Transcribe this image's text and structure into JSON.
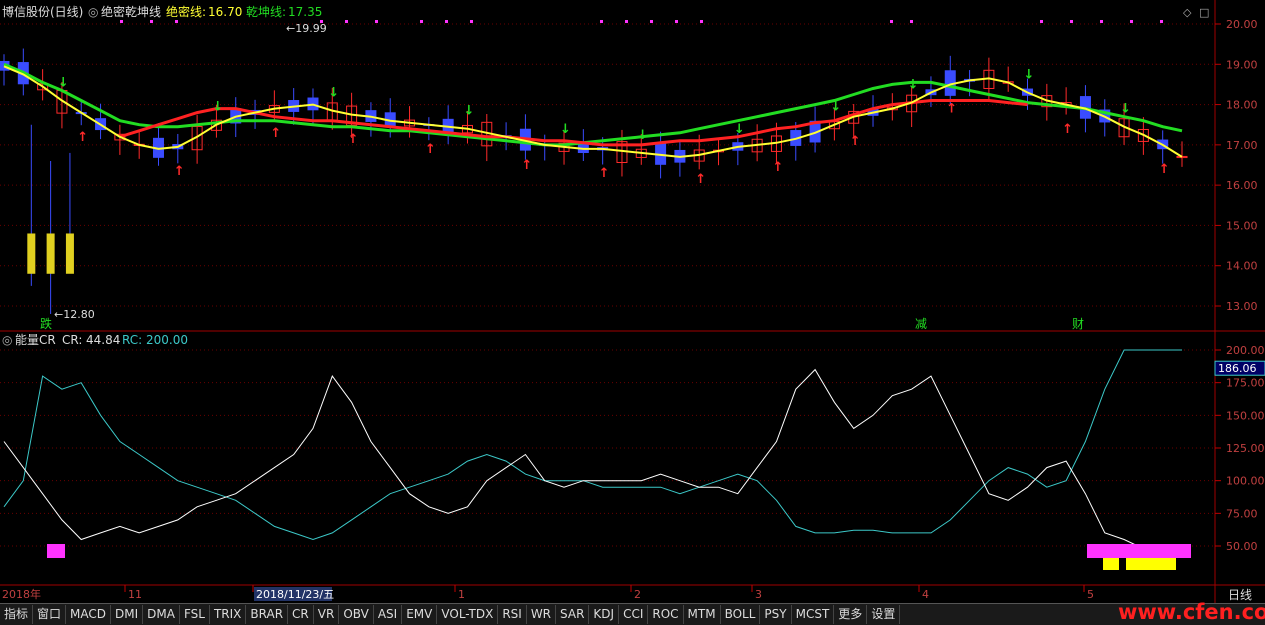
{
  "header": {
    "stock": "博信股份(日线)",
    "indicator": "绝密乾坤线",
    "line1_label": "绝密线:",
    "line1_value": "16.70",
    "line2_label": "乾坤线:",
    "line2_value": "17.35"
  },
  "sub_header": {
    "indicator": "能量CR",
    "cr_label": "CR:",
    "cr_value": "44.84",
    "rc_label": "RC:",
    "rc_value": "200.00"
  },
  "chart_data": [
    {
      "type": "candlestick",
      "title": "绝密乾坤线",
      "ylim": [
        12.6,
        20.3
      ],
      "y_ticks": [
        "20.00",
        "19.00",
        "18.00",
        "17.00",
        "16.00",
        "15.00",
        "14.00",
        "13.00"
      ],
      "annotations": {
        "high": "19.99",
        "low": "12.80"
      },
      "markers": [
        "跌",
        "减",
        "财"
      ],
      "series": [
        {
          "name": "绝密线",
          "color": "#ffff33",
          "values": [
            18.95,
            18.75,
            18.45,
            18.1,
            17.8,
            17.5,
            17.2,
            17.0,
            16.9,
            16.95,
            17.2,
            17.5,
            17.7,
            17.8,
            17.9,
            17.95,
            18.0,
            17.85,
            17.75,
            17.7,
            17.6,
            17.55,
            17.5,
            17.45,
            17.4,
            17.3,
            17.2,
            17.1,
            17.0,
            16.95,
            16.9,
            16.9,
            16.85,
            16.8,
            16.75,
            16.7,
            16.75,
            16.85,
            16.95,
            17.0,
            17.05,
            17.15,
            17.3,
            17.5,
            17.7,
            17.8,
            17.9,
            18.05,
            18.3,
            18.5,
            18.6,
            18.65,
            18.55,
            18.3,
            18.1,
            18.0,
            17.9,
            17.7,
            17.45,
            17.25,
            17.0,
            16.7
          ]
        },
        {
          "name": "乾坤线",
          "color": "#ff2222",
          "values": [
            null,
            null,
            null,
            null,
            null,
            null,
            17.2,
            17.35,
            17.5,
            17.65,
            17.8,
            17.9,
            17.9,
            17.8,
            17.7,
            17.65,
            17.6,
            17.6,
            17.55,
            17.5,
            17.45,
            17.4,
            17.35,
            17.3,
            17.25,
            17.2,
            17.2,
            17.15,
            17.1,
            17.1,
            17.05,
            17.0,
            17.0,
            17.0,
            17.05,
            17.1,
            17.1,
            17.15,
            17.2,
            17.3,
            17.4,
            17.45,
            17.55,
            17.6,
            17.75,
            17.9,
            18.0,
            18.05,
            18.1,
            18.1,
            18.1,
            18.1,
            18.05,
            18.0,
            null,
            null,
            null,
            null,
            null,
            null,
            null,
            null
          ]
        },
        {
          "name": "",
          "color": "#22dd22",
          "values": [
            19.0,
            18.8,
            18.55,
            18.35,
            18.1,
            17.85,
            17.6,
            17.5,
            17.45,
            17.45,
            17.5,
            17.55,
            17.6,
            17.6,
            17.6,
            17.55,
            17.5,
            17.45,
            17.45,
            17.4,
            17.35,
            17.35,
            17.3,
            17.25,
            17.2,
            17.15,
            17.1,
            17.05,
            17.0,
            17.0,
            17.05,
            17.1,
            17.15,
            17.2,
            17.25,
            17.3,
            17.4,
            17.5,
            17.6,
            17.7,
            17.8,
            17.9,
            18.0,
            18.1,
            18.25,
            18.4,
            18.5,
            18.55,
            18.55,
            18.45,
            18.35,
            18.25,
            18.15,
            18.05,
            18.0,
            17.95,
            17.9,
            17.8,
            17.7,
            17.6,
            17.45,
            17.35
          ]
        }
      ]
    },
    {
      "type": "line",
      "title": "能量CR",
      "ylim": [
        35,
        205
      ],
      "y_ticks": [
        "200.00",
        "175.00",
        "150.00",
        "125.00",
        "100.00",
        "75.00",
        "50.00"
      ],
      "current_value": "186.06",
      "x_tick_labels": [
        "2018年",
        "11",
        "2018/11/23/五",
        "1",
        "2",
        "3",
        "4",
        "5"
      ],
      "series": [
        {
          "name": "CR",
          "color": "#ffffff",
          "values": [
            130,
            110,
            90,
            70,
            55,
            60,
            65,
            60,
            65,
            70,
            80,
            85,
            90,
            100,
            110,
            120,
            140,
            180,
            160,
            130,
            110,
            90,
            80,
            75,
            80,
            100,
            110,
            120,
            100,
            95,
            100,
            100,
            100,
            100,
            105,
            100,
            95,
            95,
            90,
            110,
            130,
            170,
            185,
            160,
            140,
            150,
            165,
            170,
            180,
            150,
            120,
            90,
            85,
            95,
            110,
            115,
            90,
            60,
            55,
            48,
            45,
            44.84
          ]
        },
        {
          "name": "RC",
          "color": "#3cc8c8",
          "values": [
            80,
            100,
            180,
            170,
            175,
            150,
            130,
            120,
            110,
            100,
            95,
            90,
            85,
            75,
            65,
            60,
            55,
            60,
            70,
            80,
            90,
            95,
            100,
            105,
            115,
            120,
            115,
            105,
            100,
            100,
            100,
            95,
            95,
            95,
            95,
            90,
            95,
            100,
            105,
            100,
            85,
            65,
            60,
            60,
            62,
            62,
            60,
            60,
            60,
            70,
            85,
            100,
            110,
            105,
            95,
            100,
            130,
            170,
            200,
            200,
            200,
            200
          ]
        }
      ]
    }
  ],
  "toolbar": [
    "指标",
    "窗口",
    "MACD",
    "DMI",
    "DMA",
    "FSL",
    "TRIX",
    "BRAR",
    "CR",
    "VR",
    "OBV",
    "ASI",
    "EMV",
    "VOL-TDX",
    "RSI",
    "WR",
    "SAR",
    "KDJ",
    "CCI",
    "ROC",
    "MTM",
    "BOLL",
    "PSY",
    "MCST",
    "更多",
    "设置"
  ],
  "period_label": "日线",
  "watermark": "www.cfen.com"
}
